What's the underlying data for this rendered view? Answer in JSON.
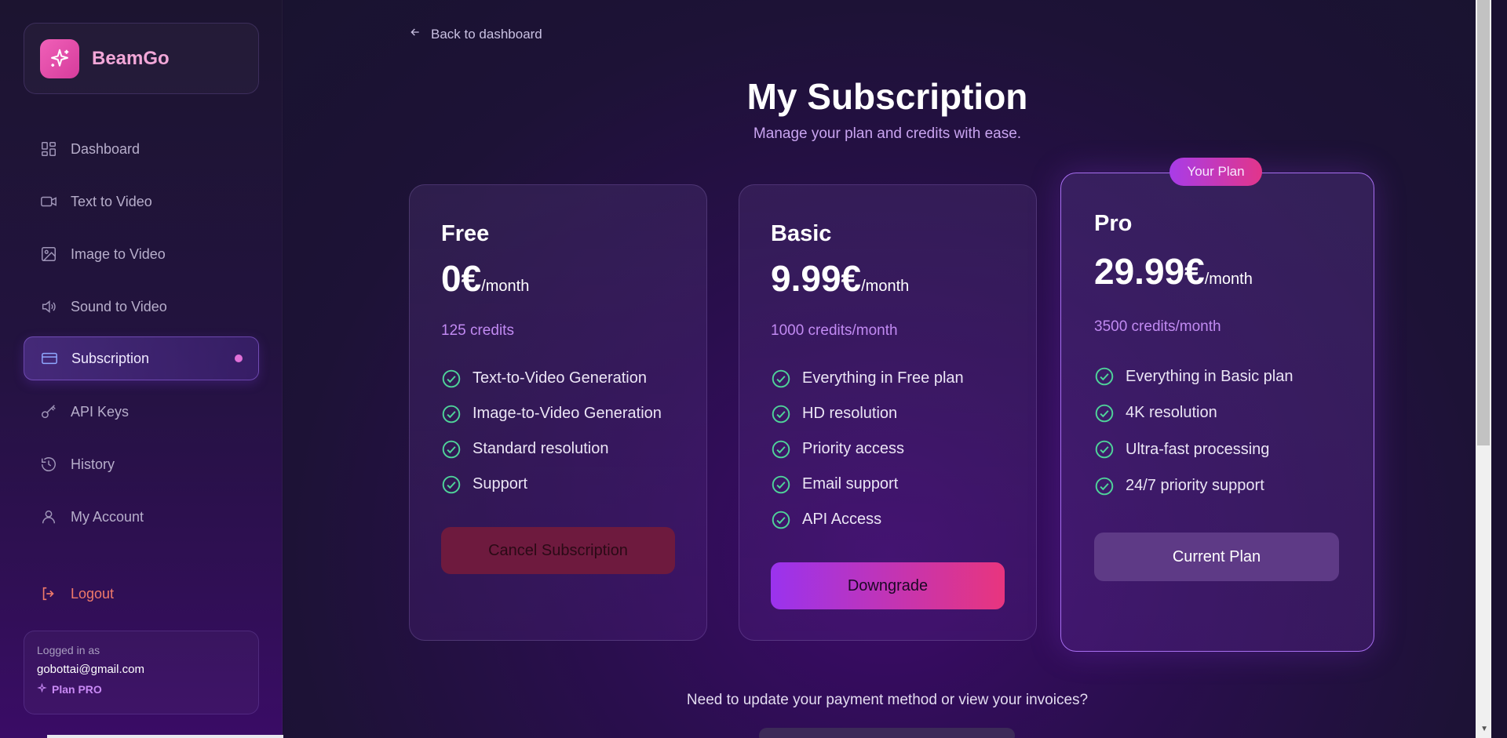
{
  "brand": {
    "name": "BeamGo",
    "logo_icon": "sparkles-icon"
  },
  "sidebar": {
    "items": [
      {
        "label": "Dashboard",
        "icon": "dashboard-icon"
      },
      {
        "label": "Text to Video",
        "icon": "video-camera-icon"
      },
      {
        "label": "Image to Video",
        "icon": "image-icon"
      },
      {
        "label": "Sound to Video",
        "icon": "speaker-icon"
      },
      {
        "label": "Subscription",
        "icon": "credit-card-icon",
        "active": true
      },
      {
        "label": "API Keys",
        "icon": "key-icon"
      },
      {
        "label": "History",
        "icon": "history-icon"
      },
      {
        "label": "My Account",
        "icon": "user-icon"
      }
    ],
    "logout": "Logout"
  },
  "user": {
    "logged_in_label": "Logged in as",
    "email": "gobottai@gmail.com",
    "plan": "Plan PRO"
  },
  "page": {
    "back": "Back to dashboard",
    "title": "My Subscription",
    "subtitle": "Manage your plan and credits with ease.",
    "help": "Need to update your payment method or view your invoices?"
  },
  "plans": [
    {
      "name": "Free",
      "price": "0€",
      "period": "/month",
      "credits": "125 credits",
      "features": [
        "Text-to-Video Generation",
        "Image-to-Video Generation",
        "Standard resolution",
        "Support"
      ],
      "button": "Cancel Subscription"
    },
    {
      "name": "Basic",
      "price": "9.99€",
      "period": "/month",
      "credits": "1000 credits/month",
      "features": [
        "Everything in Free plan",
        "HD resolution",
        "Priority access",
        "Email support",
        "API Access"
      ],
      "button": "Downgrade"
    },
    {
      "name": "Pro",
      "price": "29.99€",
      "period": "/month",
      "credits": "3500 credits/month",
      "features": [
        "Everything in Basic plan",
        "4K resolution",
        "Ultra-fast processing",
        "24/7 priority support"
      ],
      "button": "Current Plan",
      "badge": "Your Plan"
    }
  ],
  "colors": {
    "accent": "#a76ef0",
    "check": "#4fd49a",
    "logout": "#f07a6a",
    "cancel": "#6e1a3e"
  }
}
